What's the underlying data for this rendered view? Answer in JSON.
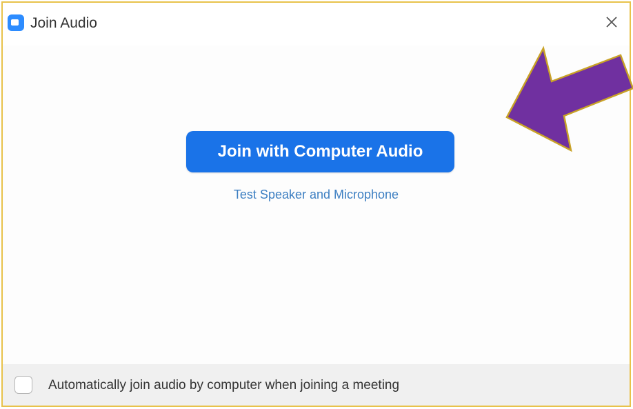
{
  "window": {
    "title": "Join Audio",
    "icon": "zoom-app-icon",
    "close_icon": "close-icon"
  },
  "main": {
    "join_button_label": "Join with Computer Audio",
    "test_link_label": "Test Speaker and Microphone"
  },
  "footer": {
    "checkbox_checked": false,
    "checkbox_label": "Automatically join audio by computer when joining a meeting"
  },
  "annotation": {
    "arrow_icon": "arrow-pointer-icon",
    "arrow_color": "#7030a0",
    "arrow_outline_color": "#c9a227"
  },
  "colors": {
    "primary_button": "#1a73e8",
    "link": "#3d7fc2",
    "dialog_border": "#e8c24a"
  }
}
